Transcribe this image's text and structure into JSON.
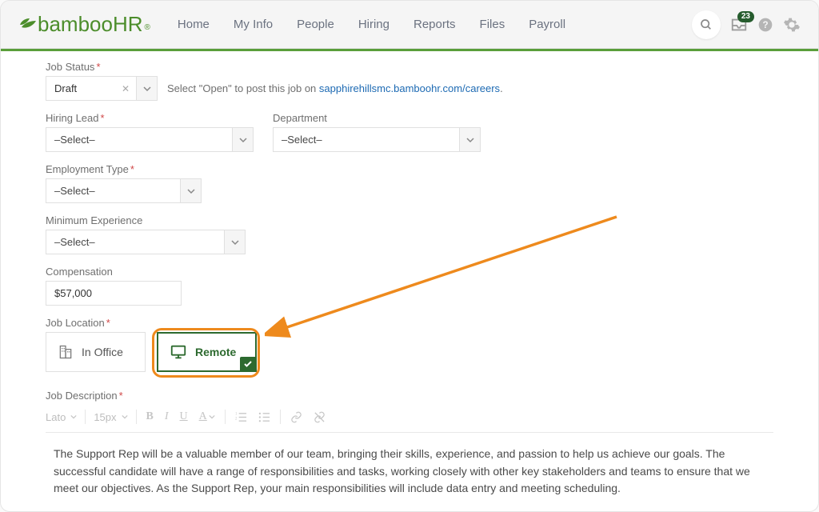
{
  "header": {
    "logo_text": "bambooHR",
    "logo_reg": "®",
    "nav": [
      "Home",
      "My Info",
      "People",
      "Hiring",
      "Reports",
      "Files",
      "Payroll"
    ],
    "badge_count": "23"
  },
  "job_status": {
    "label": "Job Status",
    "value": "Draft",
    "hint_prefix": "Select \"Open\" to post this job on ",
    "hint_link": "sapphirehillsmc.bamboohr.com/careers",
    "hint_suffix": "."
  },
  "hiring_lead": {
    "label": "Hiring Lead",
    "value": "–Select–"
  },
  "department": {
    "label": "Department",
    "value": "–Select–"
  },
  "employment_type": {
    "label": "Employment Type",
    "value": "–Select–"
  },
  "min_experience": {
    "label": "Minimum Experience",
    "value": "–Select–"
  },
  "compensation": {
    "label": "Compensation",
    "value": "$57,000"
  },
  "job_location": {
    "label": "Job Location",
    "in_office": "In Office",
    "remote": "Remote"
  },
  "job_description": {
    "label": "Job Description",
    "font": "Lato",
    "size": "15px",
    "text": "The Support Rep will be a valuable member of our team, bringing their skills, experience, and passion to help us achieve our goals. The successful candidate will have a range of responsibilities and tasks, working closely with other key stakeholders and teams to ensure that we meet our objectives. As the Support Rep, your main responsibilities will include data entry and meeting scheduling."
  }
}
